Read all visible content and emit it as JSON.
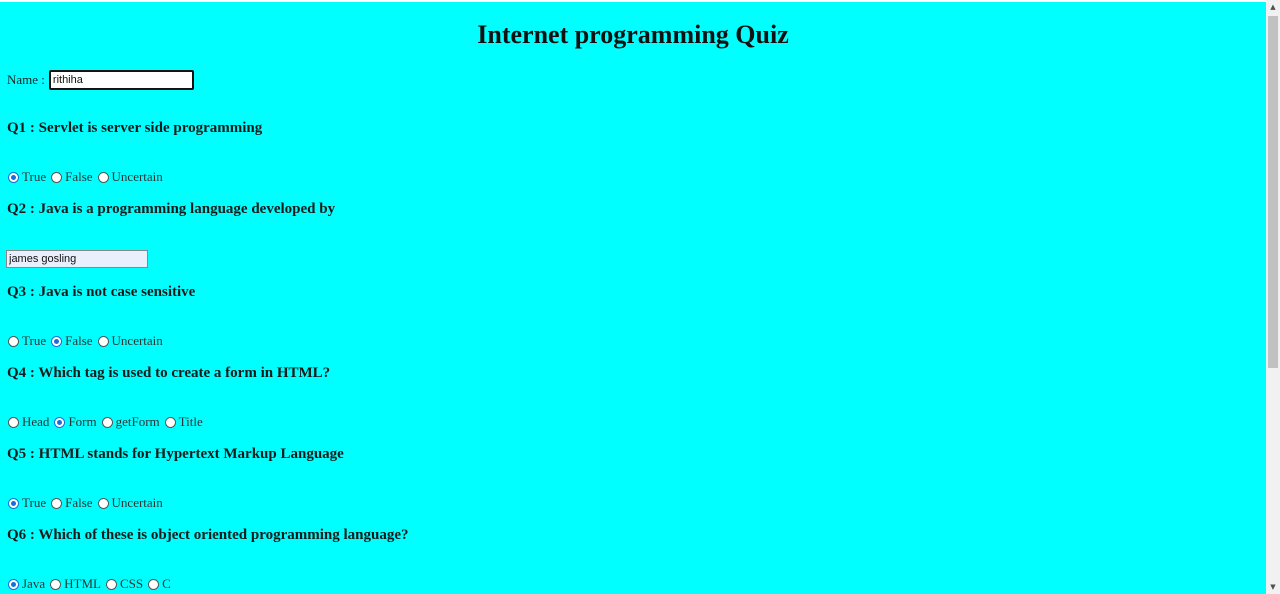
{
  "page": {
    "title": "Internet programming Quiz",
    "name_label": "Name :",
    "name_value": "rithiha",
    "background": "#00ffff"
  },
  "questions": [
    {
      "label": "Q1 : Servlet is server side programming",
      "type": "radio",
      "options": [
        {
          "label": "True",
          "checked": true
        },
        {
          "label": "False",
          "checked": false
        },
        {
          "label": "Uncertain",
          "checked": false
        }
      ]
    },
    {
      "label": "Q2 : Java is a programming language developed by",
      "type": "text",
      "value": "james gosling"
    },
    {
      "label": "Q3 : Java is not case sensitive",
      "type": "radio",
      "options": [
        {
          "label": "True",
          "checked": false
        },
        {
          "label": "False",
          "checked": true
        },
        {
          "label": "Uncertain",
          "checked": false
        }
      ]
    },
    {
      "label": "Q4 : Which tag is used to create a form in HTML?",
      "type": "radio",
      "options": [
        {
          "label": "Head",
          "checked": false
        },
        {
          "label": "Form",
          "checked": true
        },
        {
          "label": "getForm",
          "checked": false
        },
        {
          "label": "Title",
          "checked": false
        }
      ]
    },
    {
      "label": "Q5 : HTML stands for Hypertext Markup Language",
      "type": "radio",
      "options": [
        {
          "label": "True",
          "checked": true
        },
        {
          "label": "False",
          "checked": false
        },
        {
          "label": "Uncertain",
          "checked": false
        }
      ]
    },
    {
      "label": "Q6 : Which of these is object oriented programming language?",
      "type": "radio",
      "options": [
        {
          "label": "Java",
          "checked": true
        },
        {
          "label": "HTML",
          "checked": false
        },
        {
          "label": "CSS",
          "checked": false
        },
        {
          "label": "C",
          "checked": false
        }
      ]
    }
  ],
  "colors": {
    "accent": "#1a6ed8",
    "page_background": "#00ffff"
  }
}
